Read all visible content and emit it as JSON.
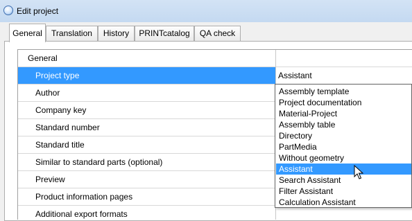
{
  "window": {
    "title": "Edit project"
  },
  "tabs": [
    "General",
    "Translation",
    "History",
    "PRINTcatalog",
    "QA check"
  ],
  "grid": {
    "category": "General",
    "rows": [
      "Project type",
      "Author",
      "Company key",
      "Standard number",
      "Standard title",
      "Similar to standard parts (optional)",
      "Preview",
      "Product information pages",
      "Additional export formats"
    ],
    "project_type_value": "Assistant"
  },
  "dropdown": {
    "options": [
      "Assembly template",
      "Project documentation",
      "Material-Project",
      "Assembly table",
      "Directory",
      "PartMedia",
      "Without geometry",
      "Assistant",
      "Search Assistant",
      "Filter Assistant",
      "Calculation Assistant"
    ],
    "highlighted": "Assistant"
  },
  "colors": {
    "selection": "#3399ff",
    "titlebar": "#c4d9f1"
  }
}
